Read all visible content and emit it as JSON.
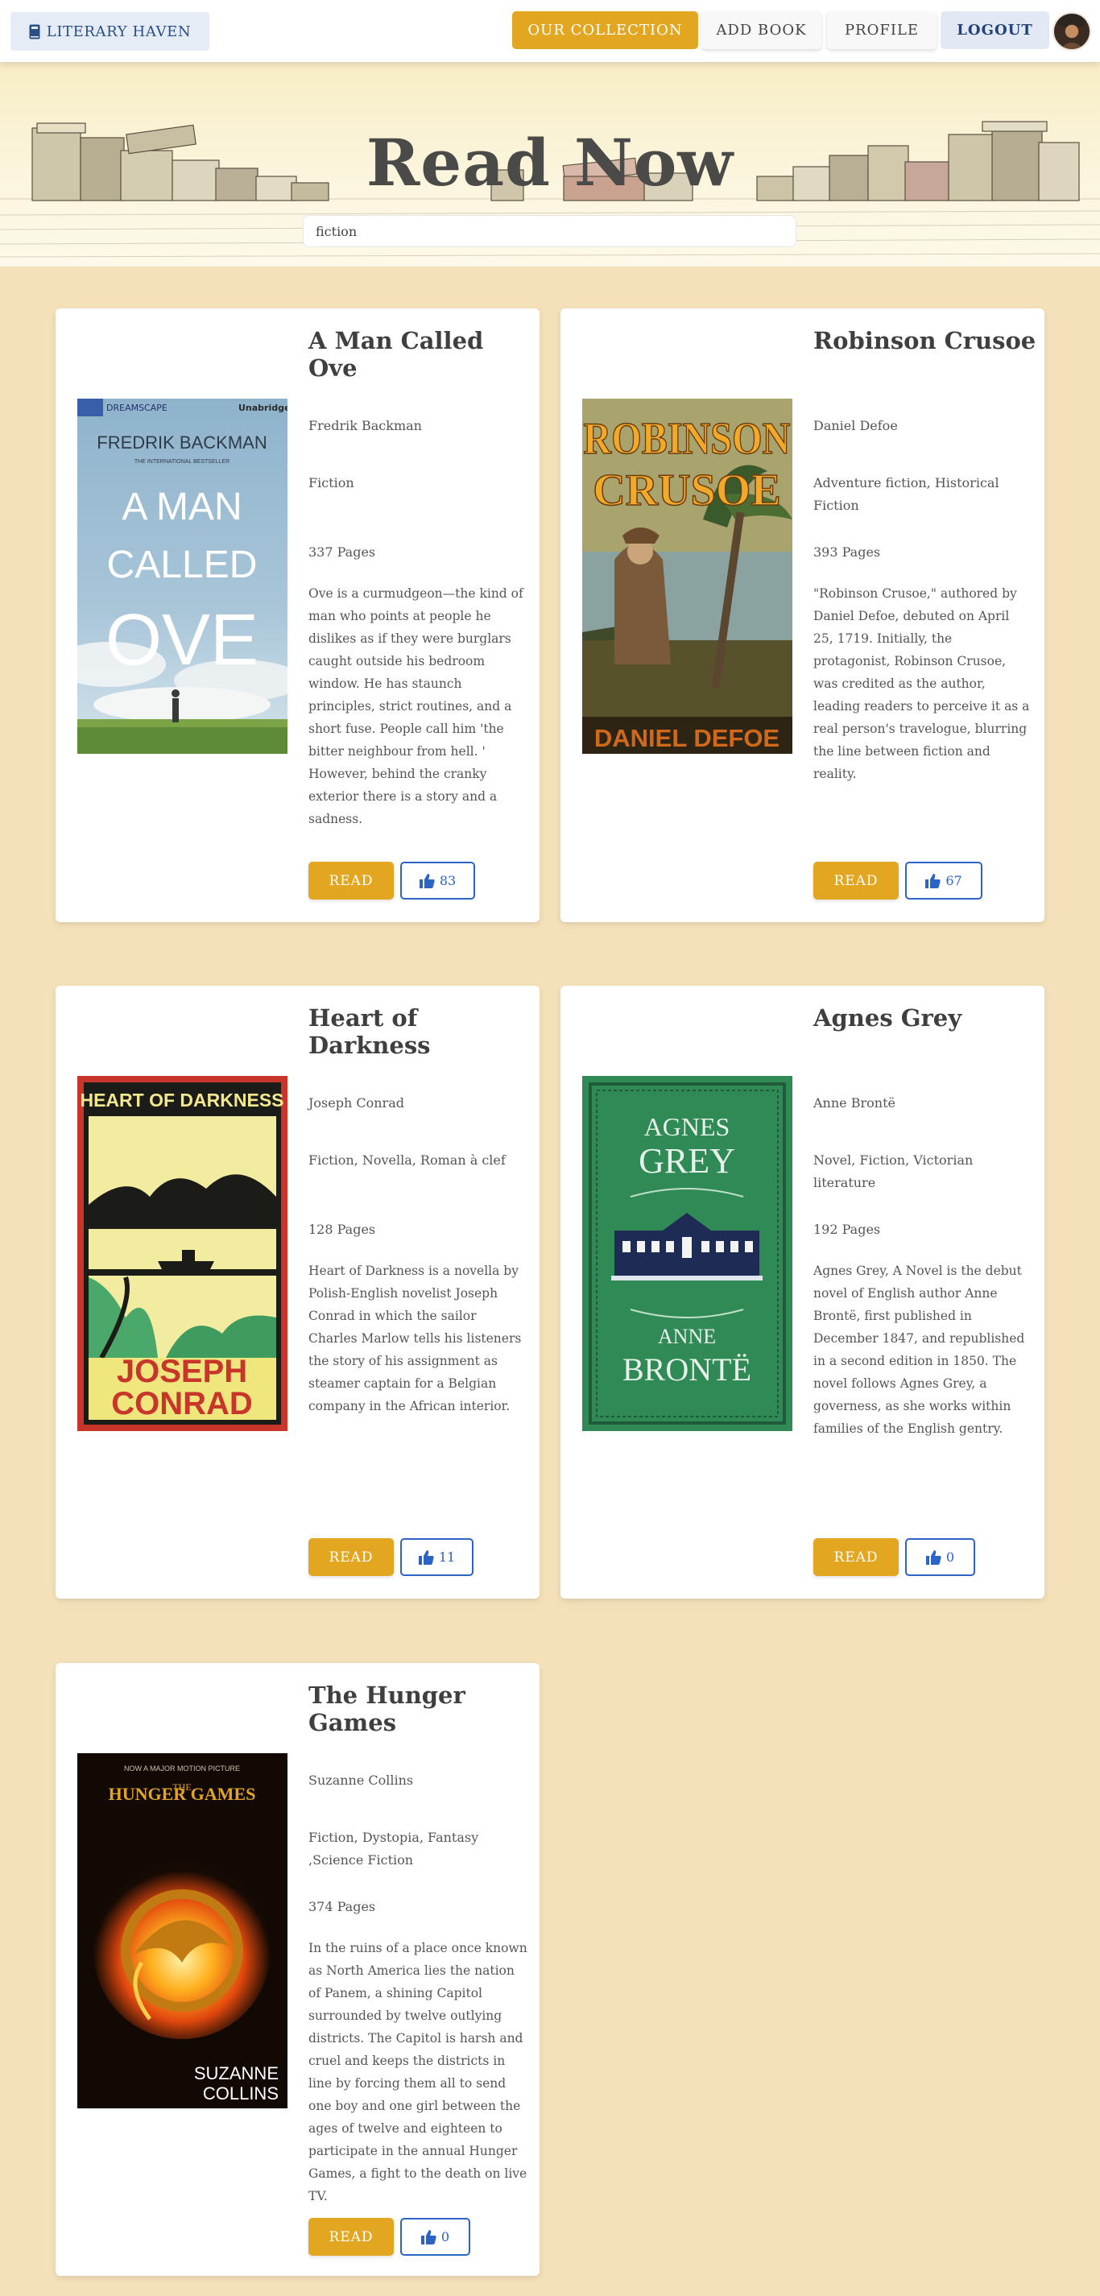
{
  "nav": {
    "brand": "LITERARY HAVEN",
    "collection": "OUR COLLECTION",
    "add_book": "ADD BOOK",
    "profile": "PROFILE",
    "logout": "LOGOUT"
  },
  "hero": {
    "title": "Read Now",
    "search_value": "fiction"
  },
  "colors": {
    "accent": "#e3a620",
    "page_background": "#f5e1b9",
    "like_blue": "#2b63c6",
    "brand_text": "#2a4f86"
  },
  "books": [
    {
      "title": "A Man Called Ove",
      "author": "Fredrik Backman",
      "genre": "Fiction",
      "pages": "337 Pages",
      "description": "Ove is a curmudgeon—the kind of man who points at people he dislikes as if they were burglars caught outside his bedroom window. He has staunch principles, strict routines, and a short fuse. People call him 'the bitter neighbour from hell. ' However, behind the cranky exterior there is a story and a sadness.",
      "read_label": "READ",
      "likes": "83",
      "cover": {
        "publisher": "DREAMSCAPE",
        "edition": "Unabridged",
        "author": "FREDRIK BACKMAN",
        "tagline": "THE INTERNATIONAL BESTSELLER",
        "lines": [
          "A MAN",
          "CALLED",
          "OVE"
        ]
      }
    },
    {
      "title": "Robinson Crusoe",
      "author": "Daniel Defoe",
      "genre": "Adventure fiction, Historical Fiction",
      "pages": "393 Pages",
      "description": "\"Robinson Crusoe,\" authored by Daniel Defoe, debuted on April 25, 1719. Initially, the protagonist, Robinson Crusoe, was credited as the author, leading readers to perceive it as a real person's travelogue, blurring the line between fiction and reality.",
      "read_label": "READ",
      "likes": "67",
      "cover": {
        "lines": [
          "ROBINSON",
          "CRUSOE"
        ],
        "author": "DANIEL DEFOE"
      }
    },
    {
      "title": "Heart of Darkness",
      "author": "Joseph Conrad",
      "genre": "Fiction, Novella, Roman à clef",
      "pages": "128 Pages",
      "description": "Heart of Darkness is a novella by Polish-English novelist Joseph Conrad in which the sailor Charles Marlow tells his listeners the story of his assignment as steamer captain for a Belgian company in the African interior.",
      "read_label": "READ",
      "likes": "11",
      "cover": {
        "title": "HEART OF DARKNESS",
        "lines": [
          "JOSEPH",
          "CONRAD"
        ]
      }
    },
    {
      "title": "Agnes Grey",
      "author": "Anne Brontë",
      "genre": "Novel, Fiction, Victorian literature",
      "pages": "192 Pages",
      "description": "Agnes Grey, A Novel is the debut novel of English author Anne Brontë, first published in December 1847, and republished in a second edition in 1850. The novel follows Agnes Grey, a governess, as she works within families of the English gentry.",
      "read_label": "READ",
      "likes": "0",
      "cover": {
        "lines": [
          "AGNES",
          "GREY"
        ],
        "author_lines": [
          "ANNE",
          "BRONTË"
        ]
      }
    },
    {
      "title": "The Hunger Games",
      "author": "Suzanne Collins",
      "genre": "Fiction, Dystopia, Fantasy ,Science Fiction",
      "pages": "374 Pages",
      "description": "In the ruins of a place once known as North America lies the nation of Panem, a shining Capitol surrounded by twelve outlying districts. The Capitol is harsh and cruel and keeps the districts in line by forcing them all to send one boy and one girl between the ages of twelve and eighteen to participate in the annual Hunger Games, a fight to the death on live TV.",
      "read_label": "READ",
      "likes": "0",
      "cover": {
        "top": "NOW A MAJOR MOTION PICTURE",
        "lines": [
          "THE",
          "HUNGER GAMES"
        ],
        "author_lines": [
          "SUZANNE",
          "COLLINS"
        ]
      }
    }
  ]
}
